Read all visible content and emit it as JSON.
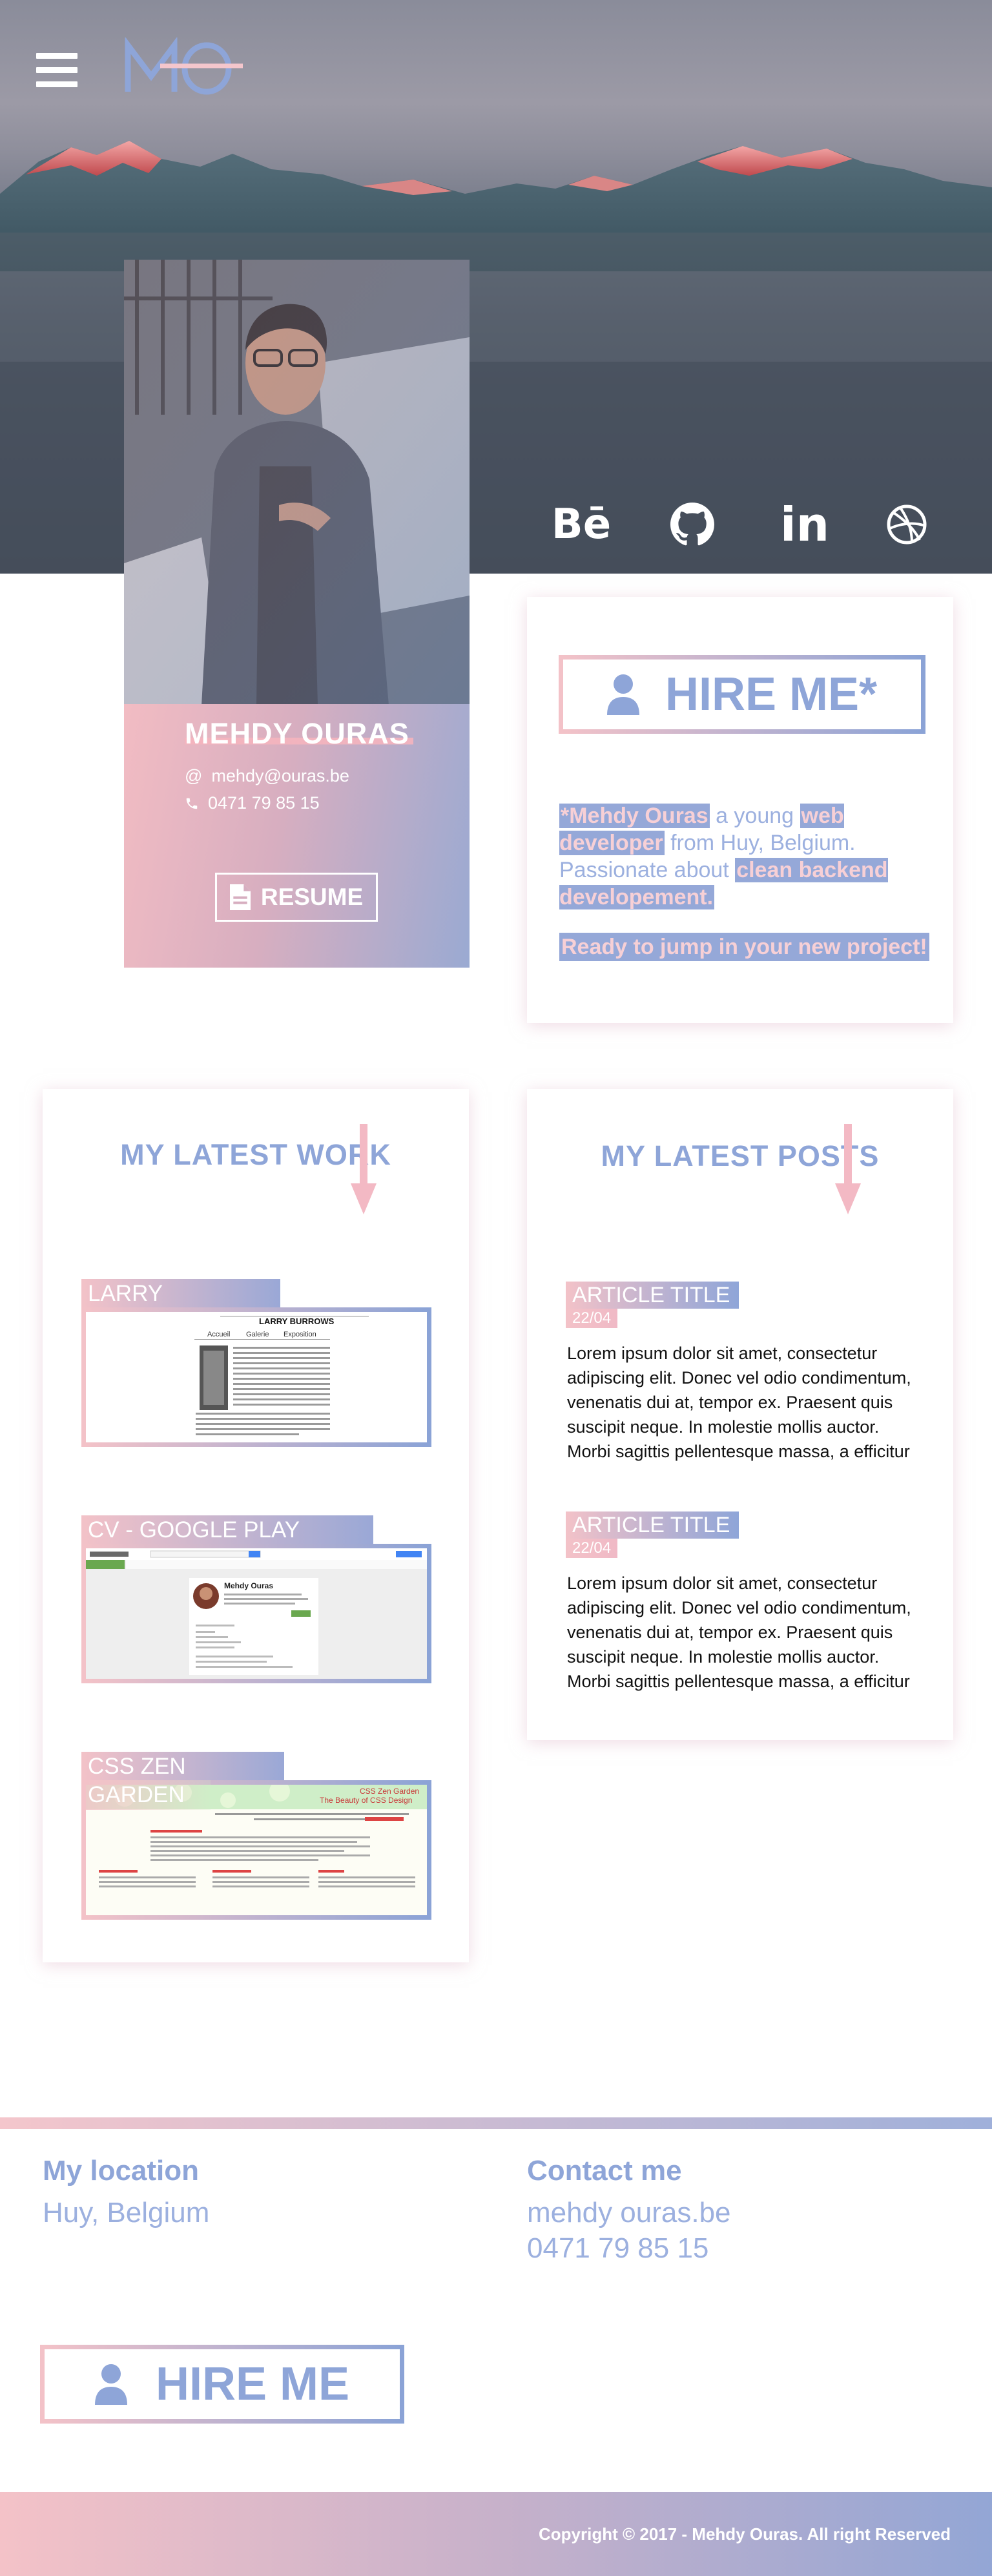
{
  "header": {
    "logo_text": "MO",
    "menu_icon": "hamburger-icon",
    "social": [
      {
        "name": "behance",
        "icon": "behance-icon",
        "glyph": "Bē"
      },
      {
        "name": "github",
        "icon": "github-icon"
      },
      {
        "name": "linkedin",
        "icon": "linkedin-icon",
        "glyph": "in"
      },
      {
        "name": "dribbble",
        "icon": "dribbble-icon"
      }
    ]
  },
  "profile": {
    "name": "MEHDY OURAS",
    "email_prefix": "@",
    "email": "mehdy@ouras.be",
    "phone": "0471 79 85 15",
    "resume_label": "RESUME"
  },
  "hire": {
    "button_label": "HIRE ME*",
    "intro": {
      "part1": "*Mehdy Ouras",
      "part2": " a young ",
      "part3": "web developer",
      "part4": " from Huy, Belgium. Passionate about ",
      "part5": "clean backend developement."
    },
    "tagline": "Ready to jump in your new project!"
  },
  "work": {
    "title": "MY LATEST WORK",
    "projects": [
      {
        "label": "LARRY",
        "shot_title": "LARRY BURROWS",
        "nav": [
          "Accueil",
          "Galerie",
          "Exposition"
        ]
      },
      {
        "label": "CV - GOOGLE PLAY STORE",
        "shot_title": "Mehdy Ouras"
      },
      {
        "label": "CSS ZEN",
        "label2": "GARDEN",
        "shot_title": "CSS Zen Garden",
        "shot_subtitle": "The Beauty of CSS Design"
      }
    ]
  },
  "posts": {
    "title": "MY LATEST POSTS",
    "articles": [
      {
        "title": "ARTICLE TITLE",
        "date": "22/04",
        "body": "Lorem ipsum dolor sit amet, consectetur adipiscing elit. Donec vel odio condimentum, venenatis dui at, tempor ex. Praesent quis suscipit neque. In molestie mollis auctor. Morbi sagittis pellentesque massa, a efficitur"
      },
      {
        "title": "ARTICLE TITLE",
        "date": "22/04",
        "body": "Lorem ipsum dolor sit amet, consectetur adipiscing elit. Donec vel odio condimentum, venenatis dui at, tempor ex. Praesent quis suscipit neque. In molestie mollis auctor. Morbi sagittis pellentesque massa, a efficitur"
      }
    ]
  },
  "footer": {
    "location_heading": "My location",
    "location": "Huy, Belgium",
    "contact_heading": "Contact me",
    "contact_site": "mehdy ouras.be",
    "contact_phone": "0471 79 85 15",
    "hire_label": "HIRE ME",
    "copyright": "Copyright © 2017 - Mehdy Ouras. All right Reserved"
  },
  "colors": {
    "accent_blue": "#8ea5d8",
    "accent_pink": "#f3c2c8"
  }
}
